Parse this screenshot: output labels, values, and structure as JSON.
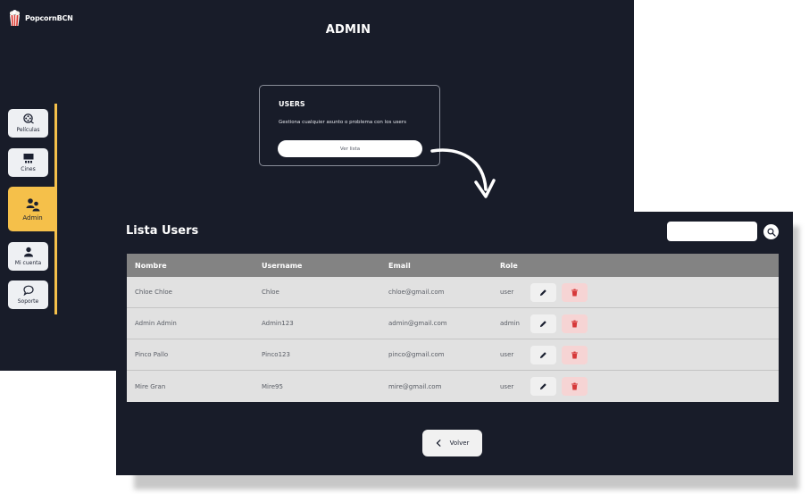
{
  "app": {
    "brand": "PopcornBCN",
    "page_title": "ADMIN"
  },
  "sidebar": {
    "items": [
      {
        "label": "Películas",
        "icon": "film-reel-icon",
        "active": false
      },
      {
        "label": "Cines",
        "icon": "cinema-screen-icon",
        "active": false
      },
      {
        "label": "Admin",
        "icon": "admin-users-icon",
        "active": true
      },
      {
        "label": "Mi cuenta",
        "icon": "user-icon",
        "active": false
      },
      {
        "label": "Soporte",
        "icon": "chat-bubble-icon",
        "active": false
      }
    ]
  },
  "users_card": {
    "title": "USERS",
    "description": "Gestiona cualquier asunto o problema con los users",
    "button_label": "Ver lista"
  },
  "user_list": {
    "title": "Lista Users",
    "search_placeholder": "",
    "columns": [
      "Nombre",
      "Username",
      "Email",
      "Role"
    ],
    "rows": [
      {
        "nombre": "Chloe Chloe",
        "username": "Chloe",
        "email": "chloe@gmail.com",
        "role": "user"
      },
      {
        "nombre": "Admin Admin",
        "username": "Admin123",
        "email": "admin@gmail.com",
        "role": "admin"
      },
      {
        "nombre": "Pinco Pallo",
        "username": "Pinco123",
        "email": "pinco@gmail.com",
        "role": "user"
      },
      {
        "nombre": "Mire Gran",
        "username": "Mire95",
        "email": "mire@gmail.com",
        "role": "user"
      }
    ],
    "back_label": "Volver"
  },
  "colors": {
    "background": "#181c29",
    "accent": "#f5c04a",
    "table_header": "#838383",
    "table_row": "#e1e1e1",
    "delete": "#d6393a"
  }
}
